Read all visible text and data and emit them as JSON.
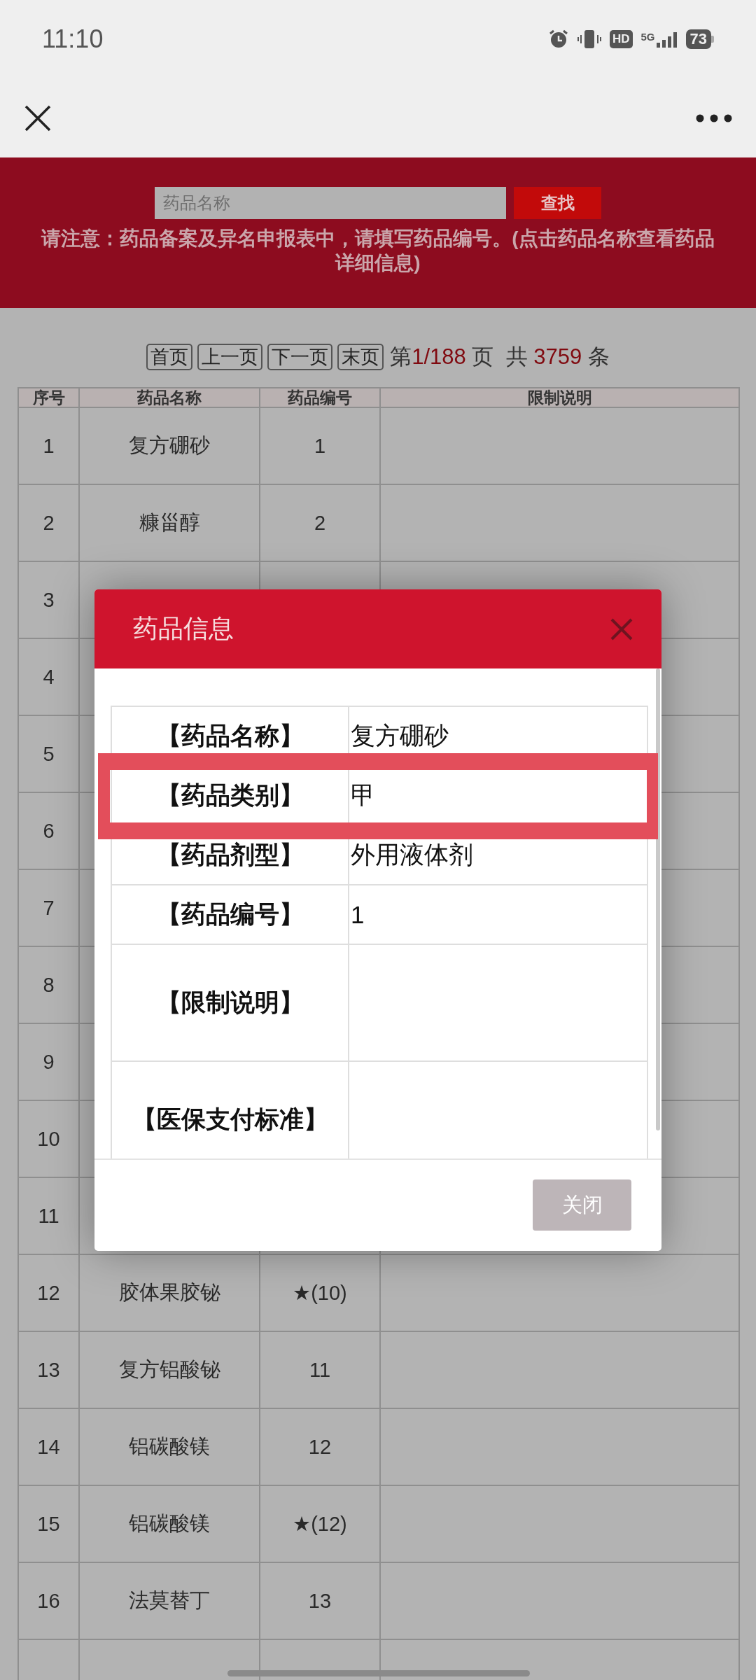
{
  "status_bar": {
    "time": "11:10",
    "hd": "HD",
    "network": "5G",
    "battery": "73"
  },
  "header": {
    "search": {
      "placeholder": "药品名称"
    },
    "search_button": "查找",
    "notice": "请注意：药品备案及异名申报表中，请填写药品编号。(点击药品名称查看药品详细信息)"
  },
  "pager": {
    "buttons": [
      "首页",
      "上一页",
      "下一页",
      "末页"
    ],
    "page_info": "第**1/188** 页  共 **3759** 条"
  },
  "table": {
    "columns": [
      "序号",
      "药品名称",
      "药品编号",
      "限制说明"
    ],
    "rows": [
      {
        "seq": "1",
        "name": "复方硼砂",
        "code": "1"
      },
      {
        "seq": "2",
        "name": "糠甾醇",
        "code": "2"
      },
      {
        "seq": "3"
      },
      {
        "seq": "4"
      },
      {
        "seq": "5"
      },
      {
        "seq": "6"
      },
      {
        "seq": "7"
      },
      {
        "seq": "8"
      },
      {
        "seq": "9"
      },
      {
        "seq": "10"
      },
      {
        "seq": "11"
      },
      {
        "seq": "12",
        "name": "胶体果胶铋",
        "code": "★(10)"
      },
      {
        "seq": "13",
        "name": "复方铝酸铋",
        "code": "11"
      },
      {
        "seq": "14",
        "name": "铝碳酸镁",
        "code": "12"
      },
      {
        "seq": "15",
        "name": "铝碳酸镁",
        "code": "★(12)"
      },
      {
        "seq": "16",
        "name": "法莫替丁",
        "code": "13"
      }
    ]
  },
  "dialog": {
    "title": "药品信息",
    "fields": [
      {
        "label": "【药品名称】",
        "value": "复方硼砂",
        "highlighted": false
      },
      {
        "label": "【药品类别】",
        "value": "甲",
        "highlighted": true
      },
      {
        "label": "【药品剂型】",
        "value": "外用液体剂",
        "highlighted": false
      },
      {
        "label": "【药品编号】",
        "value": "1",
        "highlighted": false
      },
      {
        "label": "【限制说明】",
        "highlighted": false,
        "kind": "tall"
      },
      {
        "label": "【医保支付标准】",
        "highlighted": false,
        "kind": "tall"
      }
    ],
    "close_button": "关闭"
  }
}
